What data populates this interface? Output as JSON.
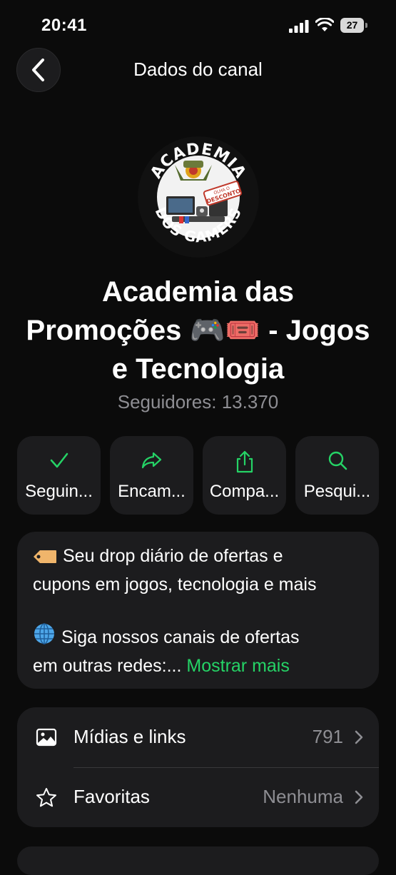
{
  "status_bar": {
    "time": "20:41",
    "battery": "27"
  },
  "header": {
    "title": "Dados do canal",
    "back_icon": "chevron-left-icon"
  },
  "channel": {
    "name_lines": [
      "Academia das",
      "Promoções 🎮🎟️ - Jogos",
      "e Tecnologia"
    ],
    "followers": "Seguidores: 13.370",
    "avatar": {
      "text_top": "ACADEMIA",
      "text_bottom": "DOS GAMERS",
      "badge_line1": "OLHA O",
      "badge_line2": "DESCONTO"
    }
  },
  "actions": [
    {
      "label": "Seguin...",
      "icon": "checkmark-icon"
    },
    {
      "label": "Encam...",
      "icon": "forward-arrow-icon"
    },
    {
      "label": "Compa...",
      "icon": "share-icon"
    },
    {
      "label": "Pesqui...",
      "icon": "search-icon"
    }
  ],
  "description": {
    "line1": "Seu drop diário de ofertas e",
    "line2": "cupons em jogos, tecnologia e mais",
    "line3": "Siga nossos canais de ofertas",
    "line4": "em outras redes:...",
    "show_more": "Mostrar mais"
  },
  "info": {
    "media": {
      "label": "Mídias e links",
      "value": "791",
      "icon": "image-icon"
    },
    "favorites": {
      "label": "Favoritas",
      "value": "Nenhuma",
      "icon": "star-icon"
    }
  },
  "colors": {
    "accent": "#25d366",
    "background": "#0b0b0b",
    "card": "#1c1c1e",
    "secondary_text": "#8e8e93"
  }
}
